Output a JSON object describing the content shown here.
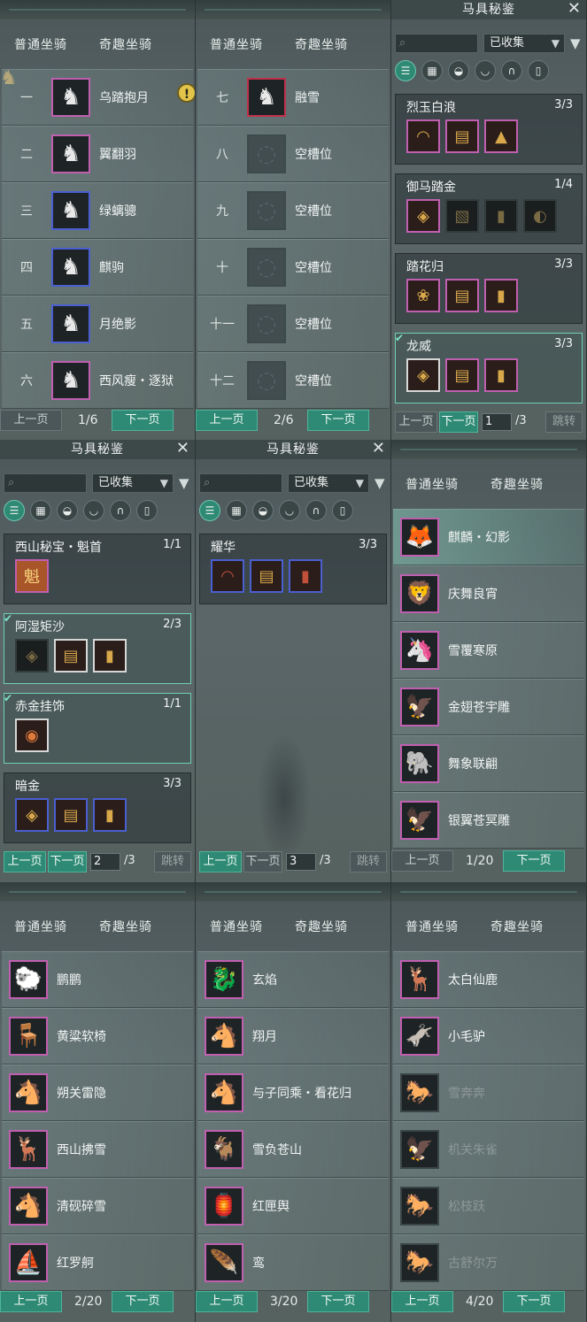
{
  "tabs": {
    "normal": "普通坐骑",
    "special": "奇趣坐骑"
  },
  "pager": {
    "prev": "上一页",
    "next": "下一页",
    "jump": "跳转"
  },
  "panel": {
    "title": "马具秘鉴",
    "filter": "已收集",
    "close": "✕"
  },
  "p1": {
    "page": "1/6",
    "rows": [
      {
        "num": "一",
        "name": "乌踏抱月",
        "icon": "horse-icon",
        "glyph": "♞"
      },
      {
        "num": "二",
        "name": "翼翻羽",
        "icon": "horse-icon",
        "glyph": "♞"
      },
      {
        "num": "三",
        "name": "绿螭骢",
        "icon": "horse-icon",
        "glyph": "♞"
      },
      {
        "num": "四",
        "name": "麒驹",
        "icon": "horse-icon",
        "glyph": "♞"
      },
      {
        "num": "五",
        "name": "月绝影",
        "icon": "horse-icon",
        "glyph": "♞"
      },
      {
        "num": "六",
        "name": "西风瘦・逐狱",
        "icon": "horse-icon",
        "glyph": "♞"
      }
    ]
  },
  "p2": {
    "page": "2/6",
    "rows": [
      {
        "num": "七",
        "name": "融雪",
        "icon": "horse-icon",
        "glyph": "♞"
      },
      {
        "num": "八",
        "name": "空槽位",
        "icon": "empty-slot-icon",
        "glyph": "◌"
      },
      {
        "num": "九",
        "name": "空槽位",
        "icon": "empty-slot-icon",
        "glyph": "◌"
      },
      {
        "num": "十",
        "name": "空槽位",
        "icon": "empty-slot-icon",
        "glyph": "◌"
      },
      {
        "num": "十一",
        "name": "空槽位",
        "icon": "empty-slot-icon",
        "glyph": "◌"
      },
      {
        "num": "十二",
        "name": "空槽位",
        "icon": "empty-slot-icon",
        "glyph": "◌"
      }
    ]
  },
  "s1": {
    "page_input": "1",
    "total": "/3",
    "cards": [
      {
        "title": "烈玉白浪",
        "count": "3/3"
      },
      {
        "title": "御马踏金",
        "count": "1/4"
      },
      {
        "title": "踏花归",
        "count": "3/3"
      },
      {
        "title": "龙威",
        "count": "3/3"
      }
    ]
  },
  "s2": {
    "page_input": "2",
    "total": "/3",
    "cards": [
      {
        "title": "西山秘宝・魁首",
        "count": "1/1"
      },
      {
        "title": "阿湿矩沙",
        "count": "2/3"
      },
      {
        "title": "赤金挂饰",
        "count": "1/1"
      },
      {
        "title": "暗金",
        "count": "3/3"
      }
    ]
  },
  "s3": {
    "page_input": "3",
    "total": "/3",
    "cards": [
      {
        "title": "耀华",
        "count": "3/3"
      }
    ]
  },
  "q1": {
    "page": "1/20",
    "rows": [
      {
        "name": "麒麟・幻影",
        "glyph": "🦊"
      },
      {
        "name": "庆舞良宵",
        "glyph": "🦁"
      },
      {
        "name": "雪覆寒原",
        "glyph": "🦄"
      },
      {
        "name": "金翅苍宇雕",
        "glyph": "🦅"
      },
      {
        "name": "舞象联翩",
        "glyph": "🐘"
      },
      {
        "name": "银翼苍冥雕",
        "glyph": "🦅"
      }
    ]
  },
  "q2": {
    "page": "2/20",
    "rows": [
      {
        "name": "鹏鹏",
        "glyph": "🐑"
      },
      {
        "name": "黄粱软椅",
        "glyph": "🪑"
      },
      {
        "name": "朔关雷隐",
        "glyph": "🐴"
      },
      {
        "name": "西山拂雪",
        "glyph": "🦌"
      },
      {
        "name": "清砚碎雪",
        "glyph": "🐴"
      },
      {
        "name": "红罗舸",
        "glyph": "⛵"
      }
    ]
  },
  "q3": {
    "page": "3/20",
    "rows": [
      {
        "name": "玄焰",
        "glyph": "🐉"
      },
      {
        "name": "翔月",
        "glyph": "🐴"
      },
      {
        "name": "与子同乘・看花归",
        "glyph": "🐴"
      },
      {
        "name": "雪负苍山",
        "glyph": "🐐"
      },
      {
        "name": "红匣舆",
        "glyph": "🏮"
      },
      {
        "name": "鸾",
        "glyph": "🪶"
      }
    ]
  },
  "q4": {
    "page": "4/20",
    "rows": [
      {
        "name": "太白仙鹿",
        "glyph": "🦌"
      },
      {
        "name": "小毛驴",
        "glyph": "🫏"
      },
      {
        "name": "雪奔奔",
        "glyph": "🐎"
      },
      {
        "name": "机关朱雀",
        "glyph": "🦅"
      },
      {
        "name": "松枝跃",
        "glyph": "🐎"
      },
      {
        "name": "古舒尔万",
        "glyph": "🐎"
      }
    ]
  },
  "colors": {
    "accent": "#2e8a74",
    "rare_border": "#c05fb0",
    "epic_border": "#4a5fd0"
  }
}
